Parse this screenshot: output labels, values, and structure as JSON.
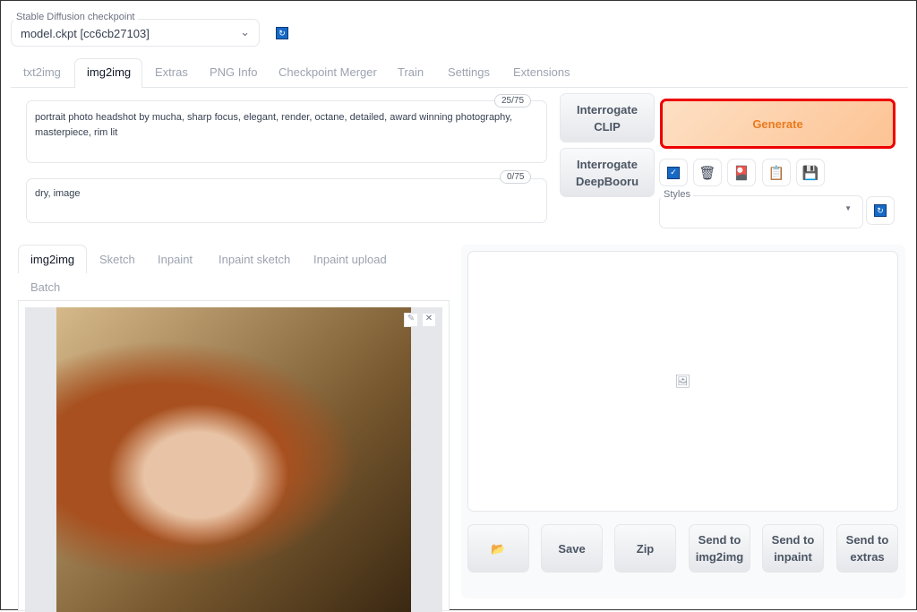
{
  "checkpoint": {
    "label": "Stable Diffusion checkpoint",
    "value": "model.ckpt [cc6cb27103]"
  },
  "tabs": [
    "txt2img",
    "img2img",
    "Extras",
    "PNG Info",
    "Checkpoint Merger",
    "Train",
    "Settings",
    "Extensions"
  ],
  "prompt": {
    "text": "portrait photo headshot by mucha, sharp focus, elegant, render, octane, detailed, award winning photography, masterpiece, rim lit",
    "count": "25/75"
  },
  "negative": {
    "text": "dry, image",
    "count": "0/75"
  },
  "buttons": {
    "interrogate_clip": "Interrogate CLIP",
    "interrogate_deepbooru": "Interrogate DeepBooru",
    "generate": "Generate"
  },
  "styles": {
    "label": "Styles",
    "value": ""
  },
  "subtabs": [
    "img2img",
    "Sketch",
    "Inpaint",
    "Inpaint sketch",
    "Inpaint upload",
    "Batch"
  ],
  "output_buttons": [
    "Save",
    "Zip",
    "Send to img2img",
    "Send to inpaint",
    "Send to extras"
  ],
  "colors": {
    "generate_bg": "#fdd5b0",
    "generate_text": "#ea7a1d",
    "generate_border": "#ee0000"
  }
}
